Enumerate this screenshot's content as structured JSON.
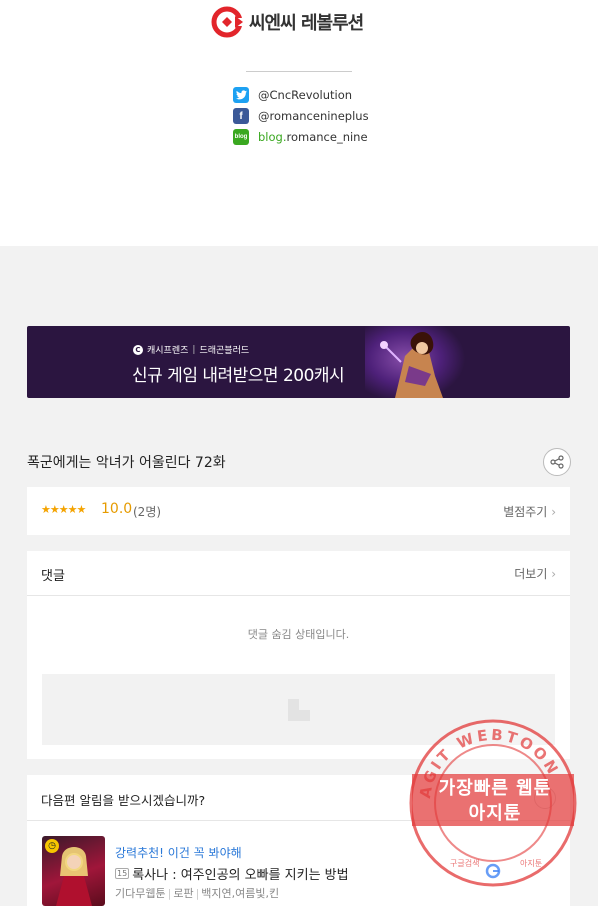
{
  "header": {
    "brand_name": "씨엔씨 레볼루션",
    "socials": [
      {
        "icon": "twitter-icon",
        "handle": "@CncRevolution",
        "color": "#1da1f2"
      },
      {
        "icon": "facebook-icon",
        "handle": "@romancenineplus",
        "color": "#3b5998"
      },
      {
        "icon": "blog-icon",
        "prefix": "blog.",
        "handle": "romance_nine",
        "color": "#3aa820"
      }
    ]
  },
  "banner": {
    "brand": "캐시프렌즈",
    "partner": "드래곤블러드",
    "headline": "신규 게임 내려받으면 200캐시"
  },
  "episode": {
    "title": "폭군에게는 악녀가 어울린다 72화"
  },
  "rating": {
    "stars": "★★★★★",
    "score": "10.0",
    "count": "(2명)",
    "rate_label": "별점주기"
  },
  "comments": {
    "title": "댓글",
    "more_label": "더보기",
    "hidden_message": "댓글 숨김 상태입니다."
  },
  "notify": {
    "question": "다음편 알림을 받으시겠습니까?",
    "recommend_label": "강력추천! 이건 꼭 봐야해",
    "age_badge": "15",
    "rec_title": "록사나 : 여주인공의 오빠를 지키는 방법",
    "meta": [
      "기다무웹툰",
      "로판",
      "백지연,여름빛,킨"
    ]
  },
  "watermark": {
    "ring_text": "AGIT WEBTOON",
    "line1": "가장빠른 웹툰",
    "line2": "아지툰",
    "bottom_left": "구글검색",
    "bottom_right": "아지툰"
  },
  "colors": {
    "brand_red": "#e2252b",
    "banner_bg": "#2b1540",
    "star": "#f4a300",
    "link_blue": "#2a78d8",
    "stamp_red": "#e23a3a"
  }
}
